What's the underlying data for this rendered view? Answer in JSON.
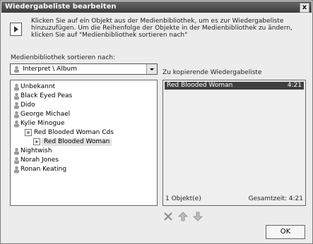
{
  "window": {
    "title": "Wiedergabeliste bearbeiten",
    "close_glyph": "x"
  },
  "instructions": "Klicken Sie auf ein Objekt aus der Medienbibliothek, um es zur Wiedergabeliste hinzuzufügen. Um die Reihenfolge der Objekte in der Medienbibliothek zu ändern, klicken Sie auf \"Medienbibliothek sortieren nach\"",
  "sort": {
    "label": "Medienbibliothek sortieren nach:",
    "value": "Interpret \\ Album"
  },
  "library": {
    "items": [
      {
        "label": "Unbekannt",
        "icon": "person-icon"
      },
      {
        "label": "Black Eyed Peas",
        "icon": "person-icon"
      },
      {
        "label": "Dido",
        "icon": "person-icon"
      },
      {
        "label": "George Michael",
        "icon": "person-icon"
      },
      {
        "label": "Kylie Minogue",
        "icon": "person-icon"
      },
      {
        "label": "Red Blooded Woman Cds",
        "icon": "album-icon"
      },
      {
        "label": "Red Blooded Woman",
        "icon": "track-icon",
        "selected": true
      },
      {
        "label": "Nightwish",
        "icon": "person-icon"
      },
      {
        "label": "Norah Jones",
        "icon": "person-icon"
      },
      {
        "label": "Ronan Keating",
        "icon": "person-icon"
      }
    ]
  },
  "playlist": {
    "label": "Zu kopierende Wiedergabeliste",
    "items": [
      {
        "name": "Red Blooded Woman",
        "time": "4:21"
      }
    ],
    "count": "1 Objekt(e)",
    "total": "Gesamtzeit: 4:21"
  },
  "toolbar": {
    "icons": [
      "delete-icon",
      "move-up-icon",
      "move-down-icon"
    ]
  },
  "ok_label": "OK"
}
